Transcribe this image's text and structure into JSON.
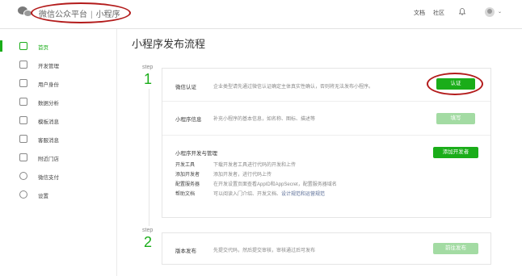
{
  "header": {
    "brand": "微信公众平台",
    "separator": "|",
    "product": "小程序",
    "nav_doc": "文档",
    "nav_community": "社区",
    "avatar_caret": "⌄"
  },
  "sidebar": {
    "items": [
      {
        "label": "首页",
        "icon": "home-icon",
        "active": true
      },
      {
        "label": "开发管理",
        "icon": "code-icon"
      },
      {
        "label": "用户身份",
        "icon": "user-icon"
      },
      {
        "label": "数据分析",
        "icon": "chart-icon"
      },
      {
        "label": "模板消息",
        "icon": "template-icon"
      },
      {
        "label": "客服消息",
        "icon": "service-icon"
      },
      {
        "label": "附近门店",
        "icon": "store-icon"
      },
      {
        "label": "微信支付",
        "icon": "pay-icon"
      },
      {
        "label": "设置",
        "icon": "settings-icon"
      }
    ]
  },
  "main": {
    "title": "小程序发布流程",
    "step1": {
      "label": "step",
      "num": "1"
    },
    "step2": {
      "label": "step",
      "num": "2"
    },
    "verify": {
      "label": "微信认证",
      "desc": "企业类型请先通过微信认证确定主体真实性确认，否则将无法发布小程序。",
      "button": "认证"
    },
    "info": {
      "label": "小程序信息",
      "desc": "补充小程序的基本信息，如名称、图标、描述等",
      "button": "填写"
    },
    "dev": {
      "label": "小程序开发与管理",
      "button": "添加开发者",
      "rows": [
        {
          "label": "开发工具",
          "desc": "下载开发者工具进行代码的开发和上传"
        },
        {
          "label": "添加开发者",
          "desc": "添加开发者，进行代码上传"
        },
        {
          "label": "配置服务器",
          "desc": "在开发设置页面查看AppID和AppSecret，配置服务器域名"
        },
        {
          "label": "帮助文档",
          "desc_prefix": "可以阅读入门介绍、开发文档、",
          "link": "设计规范和运营规范"
        }
      ]
    },
    "publish": {
      "label": "版本发布",
      "desc": "先提交代码，然后提交审核，审核通过后可发布",
      "button": "前往发布"
    }
  },
  "colors": {
    "accent": "#1aad19",
    "annotation": "#b31b1b",
    "disabled_button": "#a3dba3"
  }
}
